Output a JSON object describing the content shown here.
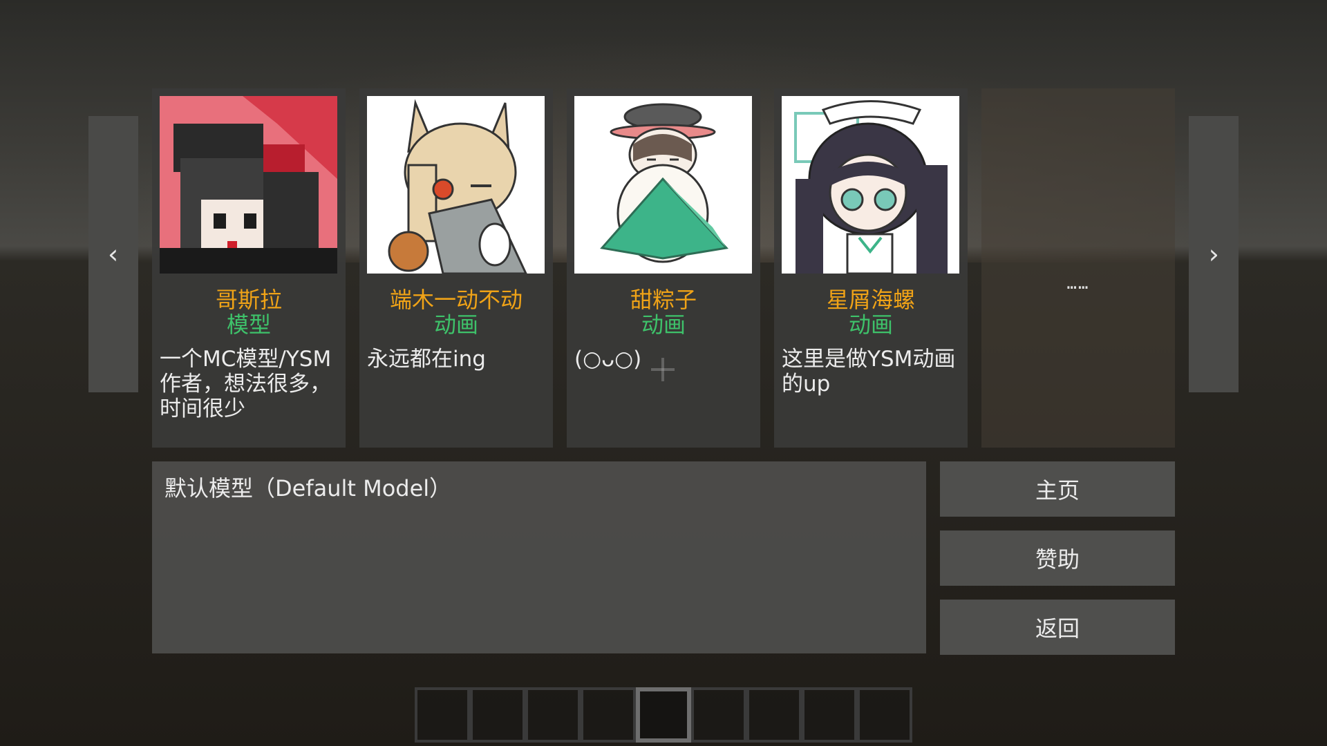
{
  "nav": {
    "prev_icon": "chevron-left-icon",
    "prev_glyph": "‹",
    "next_icon": "chevron-right-icon",
    "next_glyph": "›"
  },
  "authors": [
    {
      "name": "哥斯拉",
      "type": "模型",
      "description": "一个MC模型/YSM作者，想法很多，时间很少"
    },
    {
      "name": "端木一动不动",
      "type": "动画",
      "description": "永远都在ing"
    },
    {
      "name": "甜粽子",
      "type": "动画",
      "description": "(○ᴗ○)"
    },
    {
      "name": "星屑海螺",
      "type": "动画",
      "description": "这里是做YSM动画的up"
    }
  ],
  "more_card": {
    "text": "……"
  },
  "model": {
    "label": "默认模型（Default Model）"
  },
  "buttons": {
    "home": "主页",
    "sponsor": "赞助",
    "back": "返回"
  },
  "colors": {
    "name": "#f0a317",
    "type": "#3ec26a",
    "text": "#ececec"
  }
}
